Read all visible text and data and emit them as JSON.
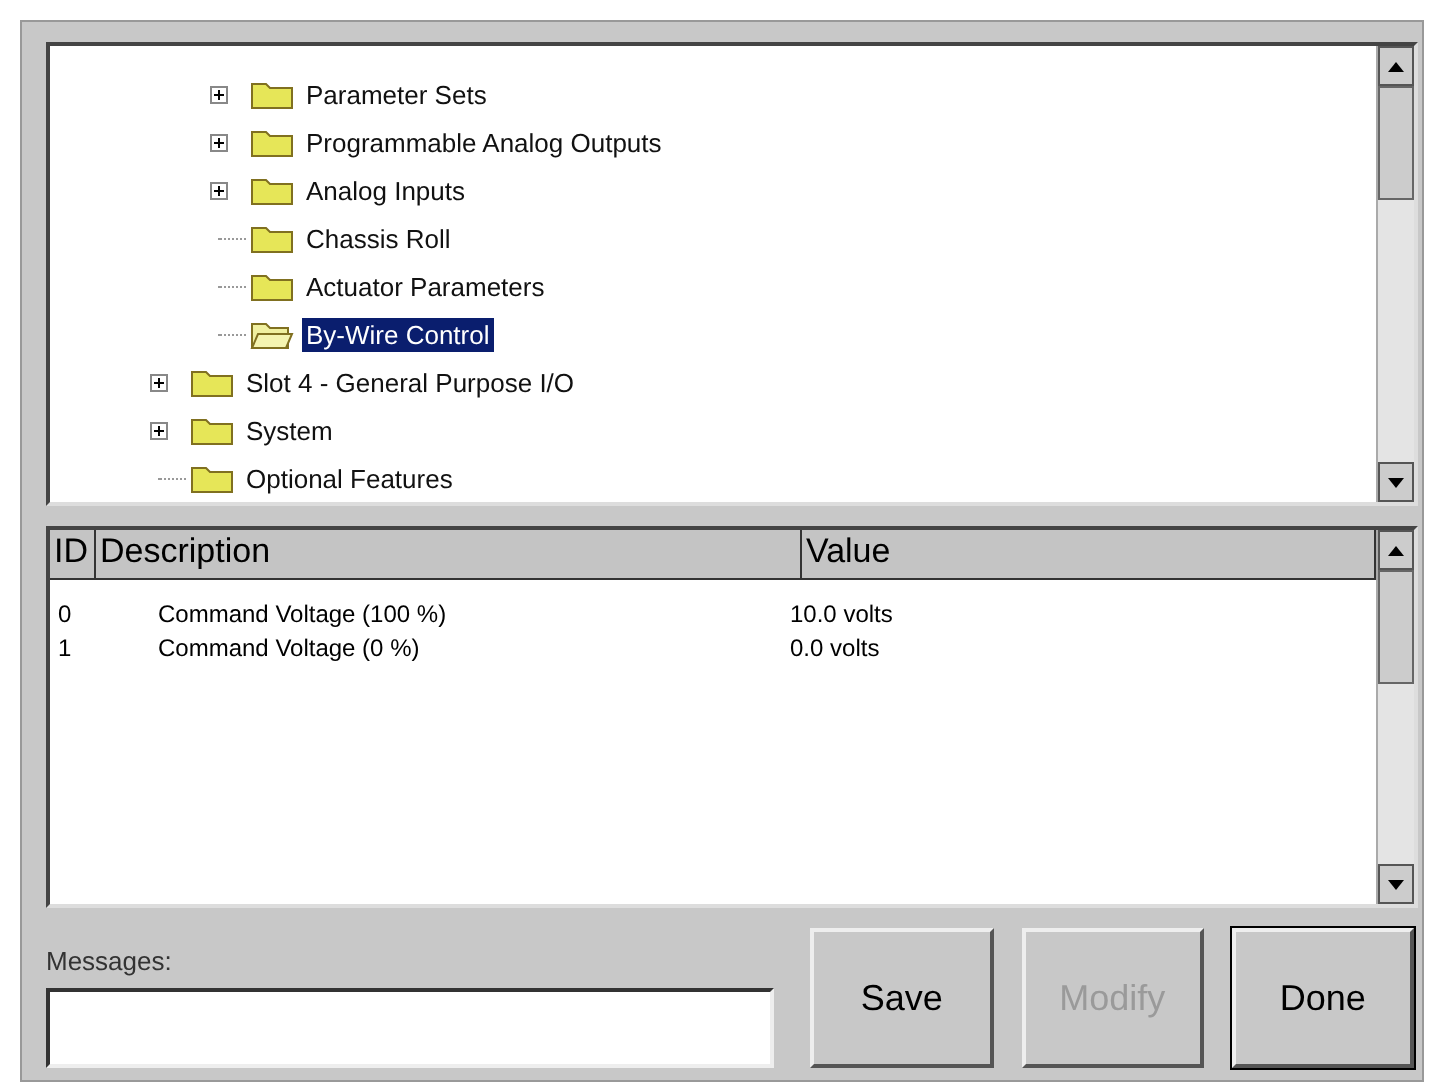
{
  "tree": {
    "items": [
      {
        "children": [
          {
            "label": "Parameter Sets",
            "expandable": true,
            "selected": false
          },
          {
            "label": "Programmable Analog Outputs",
            "expandable": true,
            "selected": false
          },
          {
            "label": "Analog Inputs",
            "expandable": true,
            "selected": false
          },
          {
            "label": "Chassis Roll",
            "expandable": false,
            "selected": false
          },
          {
            "label": "Actuator Parameters",
            "expandable": false,
            "selected": false
          },
          {
            "label": "By-Wire Control",
            "expandable": false,
            "selected": true
          }
        ]
      },
      {
        "label": "Slot 4 - General Purpose I/O",
        "expandable": true,
        "selected": false
      },
      {
        "label": "System",
        "expandable": true,
        "selected": false
      },
      {
        "label": "Optional Features",
        "expandable": false,
        "selected": false
      }
    ]
  },
  "table": {
    "columns": [
      "ID",
      "Description",
      "Value"
    ],
    "rows": [
      {
        "id": "0",
        "description": "Command Voltage  (100 %)",
        "value": "10.0  volts"
      },
      {
        "id": "1",
        "description": "Command Voltage  (0 %)",
        "value": "0.0  volts"
      }
    ]
  },
  "messages": {
    "label": "Messages:"
  },
  "buttons": [
    {
      "label": "Save",
      "disabled": false
    },
    {
      "label": "Modify",
      "disabled": true
    },
    {
      "label": "Done",
      "disabled": false
    }
  ]
}
